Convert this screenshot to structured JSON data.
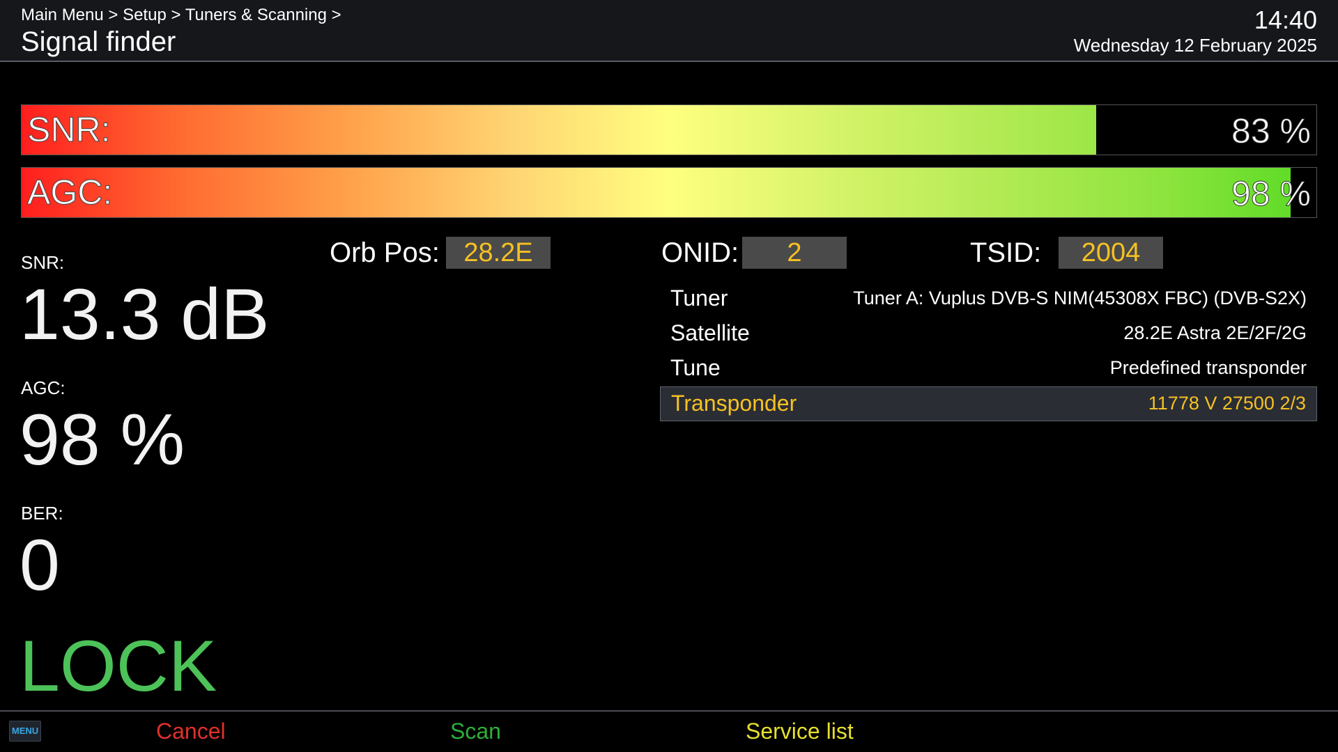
{
  "header": {
    "breadcrumb": "Main Menu > Setup > Tuners & Scanning >",
    "title": "Signal finder",
    "time": "14:40",
    "date": "Wednesday 12 February 2025"
  },
  "bars": {
    "snr": {
      "label": "SNR:",
      "value_text": "83 %",
      "level": 0.83
    },
    "agc": {
      "label": "AGC:",
      "value_text": "98 %",
      "level": 0.98
    }
  },
  "metrics": {
    "snr_label": "SNR:",
    "snr_value": "13.3 dB",
    "agc_label": "AGC:",
    "agc_value": "98 %",
    "ber_label": "BER:",
    "ber_value": "0",
    "lock_status": "LOCK"
  },
  "fields": {
    "orb_pos_label": "Orb Pos:",
    "orb_pos_value": "28.2E",
    "onid_label": "ONID:",
    "onid_value": "2",
    "tsid_label": "TSID:",
    "tsid_value": "2004"
  },
  "settings": [
    {
      "label": "Tuner",
      "value": "Tuner A: Vuplus DVB-S NIM(45308X FBC) (DVB-S2X)",
      "selected": false
    },
    {
      "label": "Satellite",
      "value": "28.2E Astra 2E/2F/2G",
      "selected": false
    },
    {
      "label": "Tune",
      "value": "Predefined transponder",
      "selected": false
    },
    {
      "label": "Transponder",
      "value": "11778 V 27500 2/3",
      "selected": true
    }
  ],
  "footer": {
    "menu_key": "MENU",
    "cancel": "Cancel",
    "scan": "Scan",
    "service_list": "Service list"
  },
  "colors": {
    "accent_yellow": "#f6c122",
    "lock_green": "#4cc259",
    "cancel_red": "#e0302a",
    "scan_green": "#2fae3a",
    "service_yellow": "#e6df2e",
    "menu_blue": "#3aa7e4"
  }
}
